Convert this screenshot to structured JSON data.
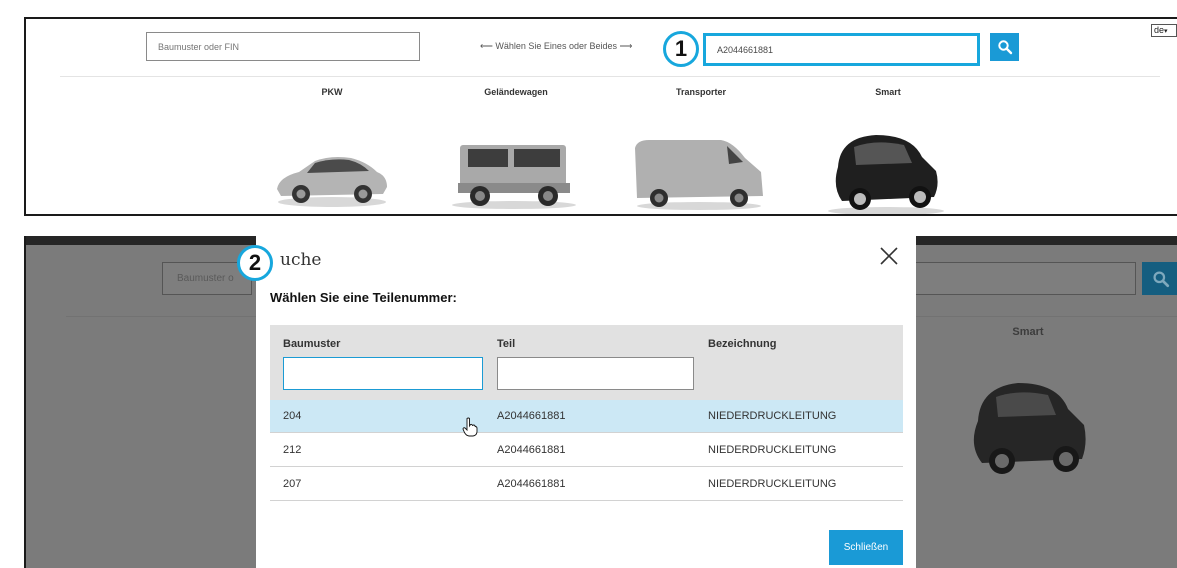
{
  "step1": {
    "badge": "1",
    "fin_placeholder": "Baumuster oder FIN",
    "hint": "⟵ Wählen Sie Eines oder Beides ⟶",
    "part_value": "A2044661881",
    "lang": "de",
    "categories": [
      "PKW",
      "Geländewagen",
      "Transporter",
      "Smart"
    ],
    "accent_color": "#17a7dd",
    "icons": [
      "search-icon",
      "car-suv-coupe",
      "car-g-class",
      "van-sprinter",
      "car-smart"
    ]
  },
  "step2": {
    "badge": "2",
    "background": {
      "fin_placeholder": "Baumuster o",
      "category": "Smart"
    },
    "modal": {
      "title": "uche",
      "subtitle": "Wählen Sie eine Teilenummer:",
      "columns": [
        "Baumuster",
        "Teil",
        "Bezeichnung"
      ],
      "rows": [
        {
          "baumuster": "204",
          "teil": "A2044661881",
          "bezeichnung": "NIEDERDRUCKLEITUNG",
          "selected": true
        },
        {
          "baumuster": "212",
          "teil": "A2044661881",
          "bezeichnung": "NIEDERDRUCKLEITUNG",
          "selected": false
        },
        {
          "baumuster": "207",
          "teil": "A2044661881",
          "bezeichnung": "NIEDERDRUCKLEITUNG",
          "selected": false
        }
      ],
      "close_label": "Schließen"
    }
  }
}
